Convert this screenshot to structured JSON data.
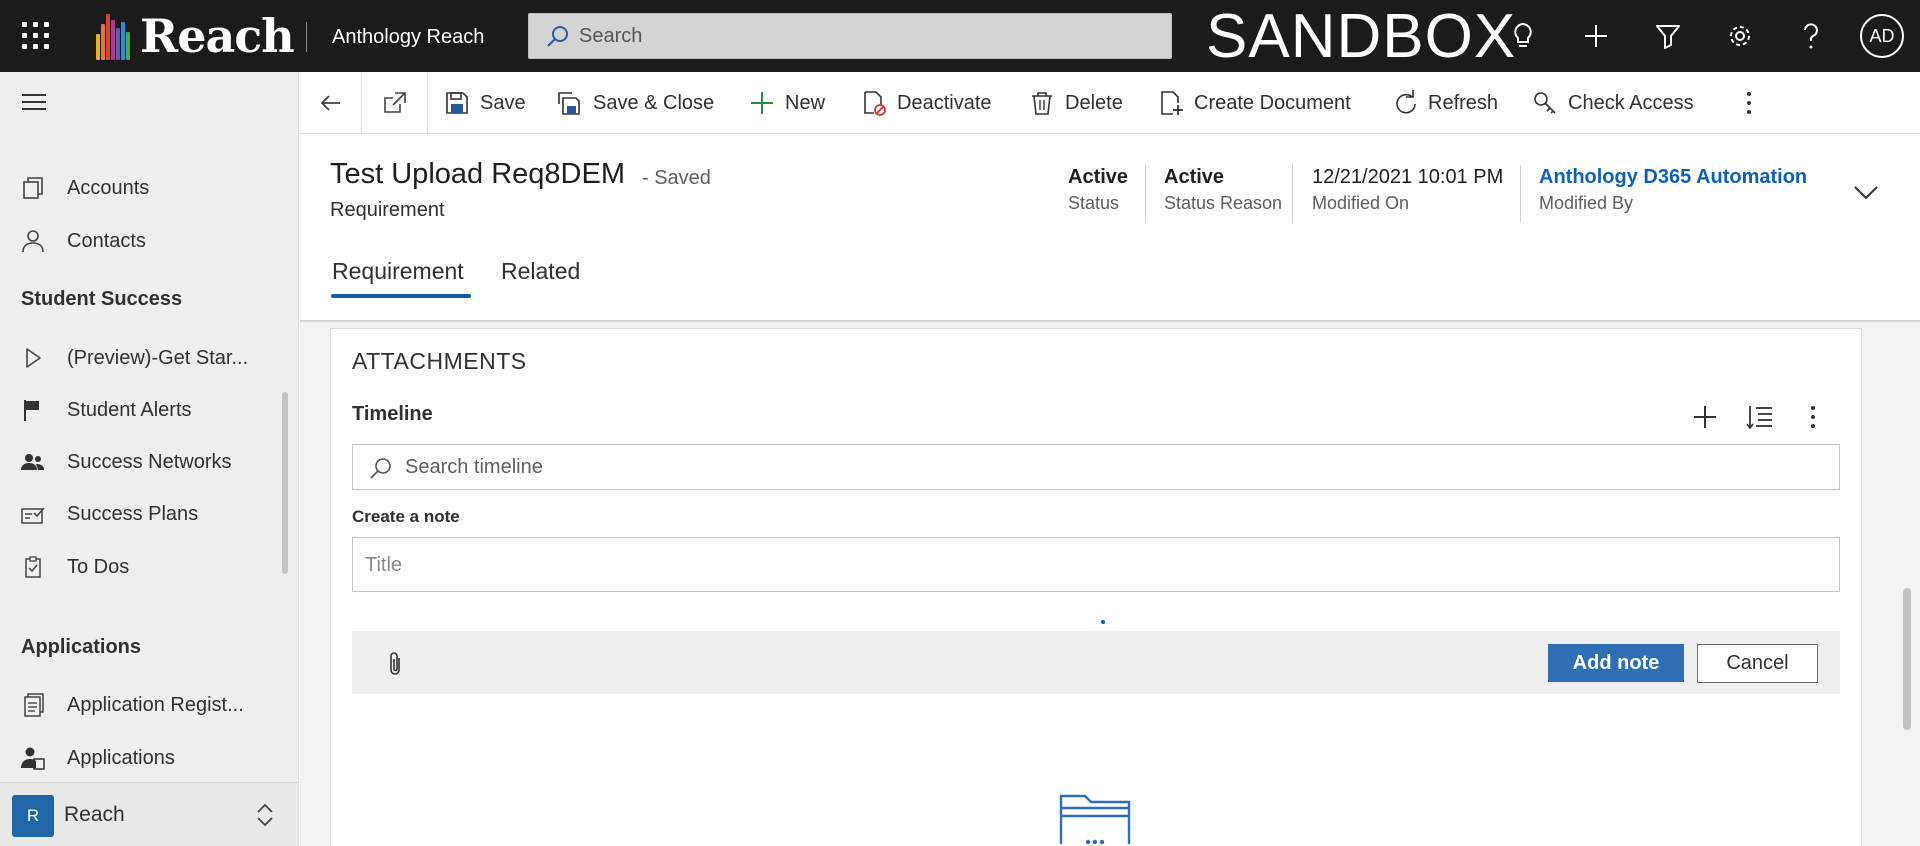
{
  "topbar": {
    "brand": "Reach",
    "app_name": "Anthology Reach",
    "search_placeholder": "Search",
    "environment_label": "SANDBOX",
    "icons": [
      "lightbulb-icon",
      "plus-icon",
      "filter-icon",
      "gear-icon",
      "help-icon"
    ],
    "user_initials": "AD"
  },
  "sidebar": {
    "items_top": [
      {
        "label": "Accounts",
        "icon": "accounts-icon"
      },
      {
        "label": "Contacts",
        "icon": "person-icon"
      }
    ],
    "groups": [
      {
        "title": "Student Success",
        "items": [
          {
            "label": "(Preview)-Get Star...",
            "icon": "play-icon"
          },
          {
            "label": "Student Alerts",
            "icon": "flag-icon"
          },
          {
            "label": "Success Networks",
            "icon": "people-icon"
          },
          {
            "label": "Success Plans",
            "icon": "plan-icon"
          },
          {
            "label": "To Dos",
            "icon": "clipboard-icon"
          }
        ]
      },
      {
        "title": "Applications",
        "items": [
          {
            "label": "Application Regist...",
            "icon": "document-icon"
          },
          {
            "label": "Applications",
            "icon": "applicant-icon"
          }
        ]
      }
    ],
    "area": {
      "badge": "R",
      "name": "Reach"
    }
  },
  "commandbar": {
    "save": "Save",
    "save_close": "Save & Close",
    "new": "New",
    "deactivate": "Deactivate",
    "delete": "Delete",
    "create_document": "Create Document",
    "refresh": "Refresh",
    "check_access": "Check Access"
  },
  "record": {
    "title": "Test Upload Req8DEM",
    "saved_status": "- Saved",
    "entity": "Requirement",
    "header_fields": [
      {
        "value": "Active",
        "label": "Status"
      },
      {
        "value": "Active",
        "label": "Status Reason"
      },
      {
        "value": "12/21/2021 10:01 PM",
        "label": "Modified On"
      },
      {
        "value": "Anthology D365 Automation",
        "label": "Modified By"
      }
    ],
    "tabs": [
      {
        "label": "Requirement",
        "active": true
      },
      {
        "label": "Related",
        "active": false
      }
    ]
  },
  "attachments": {
    "section_title": "ATTACHMENTS",
    "timeline_title": "Timeline",
    "search_placeholder": "Search timeline",
    "create_note_label": "Create a note",
    "title_placeholder": "Title",
    "add_note": "Add note",
    "cancel": "Cancel"
  },
  "colors": {
    "topbar": "#1b1b1b",
    "accent": "#115ea3",
    "link": "#1160b7",
    "primary_button": "#2f6fb6"
  }
}
